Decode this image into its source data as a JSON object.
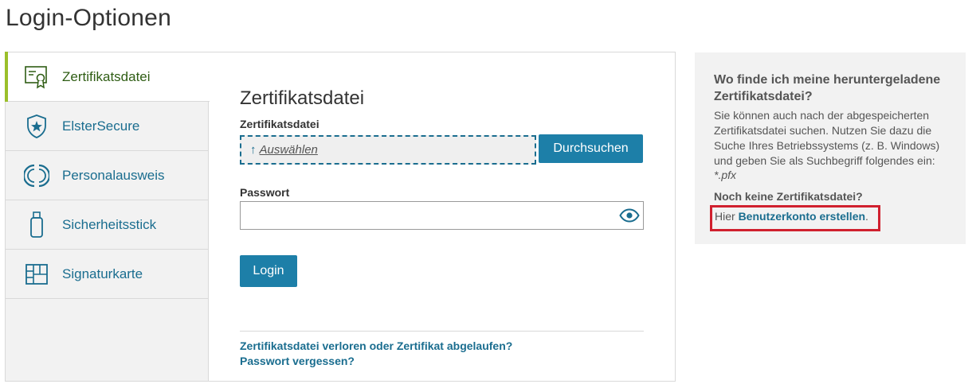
{
  "page": {
    "title": "Login-Optionen"
  },
  "tabs": [
    {
      "label": "Zertifikatsdatei",
      "icon": "certificate-icon",
      "active": true
    },
    {
      "label": "ElsterSecure",
      "icon": "shield-star-icon",
      "active": false
    },
    {
      "label": "Personalausweis",
      "icon": "id-card-chip-icon",
      "active": false
    },
    {
      "label": "Sicherheitsstick",
      "icon": "usb-stick-icon",
      "active": false
    },
    {
      "label": "Signaturkarte",
      "icon": "smartcard-icon",
      "active": false
    }
  ],
  "form": {
    "heading": "Zertifikatsdatei",
    "file_label": "Zertifikatsdatei",
    "file_choose": "Auswählen",
    "browse_button": "Durchsuchen",
    "password_label": "Passwort",
    "password_value": "",
    "login_button": "Login",
    "link_lost": "Zertifikatsdatei verloren oder Zertifikat abgelaufen?",
    "link_forgot": "Passwort vergessen?"
  },
  "help": {
    "title": "Wo finde ich meine heruntergeladene Zertifikatsdatei?",
    "text": "Sie können auch nach der abgespeicherten Zertifikatsdatei suchen. Nutzen Sie dazu die Suche Ihres Betriebssystems (z. B. Windows) und geben Sie als Suchbegriff folgendes ein:",
    "extension": "*.pfx",
    "no_file": "Noch keine Zertifikatsdatei?",
    "create_prefix": "Hier ",
    "create_link": "Benutzerkonto erstellen",
    "create_suffix": "."
  },
  "colors": {
    "accent": "#1d7fa8",
    "link": "#1a6d8f",
    "active_bar": "#9bbf2a",
    "highlight": "#d0202e"
  }
}
